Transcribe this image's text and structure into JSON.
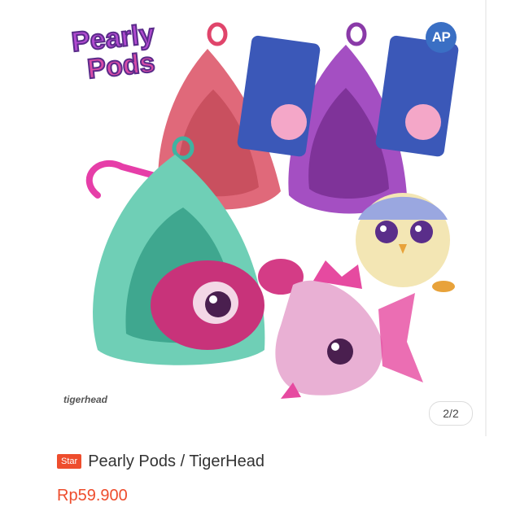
{
  "product_image": {
    "brand_logo_text": "Pearly Pods",
    "maker_logo_text": "tigerhead",
    "avatar_initials": "AP",
    "page_indicator": "2/2"
  },
  "product": {
    "badge": "Star",
    "title": "Pearly Pods / TigerHead",
    "price": "Rp59.900"
  },
  "colors": {
    "price_accent": "#ee4d2d",
    "badge_bg": "#ee4d2d",
    "avatar_bg": "#3a6fc4"
  }
}
